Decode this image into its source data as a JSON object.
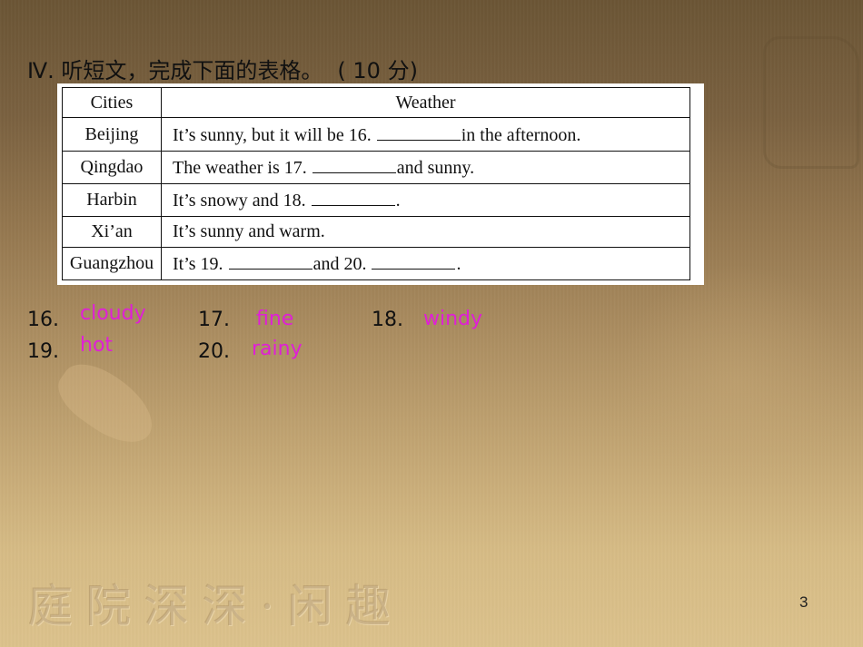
{
  "slide": {
    "heading": "Ⅳ. 听短文，完成下面的表格。",
    "score": "( 10 分)",
    "page_number": "3",
    "footer_seal_text": "庭院深深·闲趣"
  },
  "table": {
    "headers": [
      "Cities",
      "Weather"
    ],
    "rows": [
      {
        "city": "Beijing",
        "before": "It’s sunny, but it will be 16.",
        "blank_after": true,
        "after": "in the afternoon.",
        "before2": "",
        "blank2": false,
        "after2": ""
      },
      {
        "city": "Qingdao",
        "before": "The weather is 17.",
        "blank_after": true,
        "after": "and sunny.",
        "before2": "",
        "blank2": false,
        "after2": ""
      },
      {
        "city": "Harbin",
        "before": "It’s snowy and 18.",
        "blank_after": true,
        "after": ".",
        "before2": "",
        "blank2": false,
        "after2": ""
      },
      {
        "city": "Xi’an",
        "before": "It’s sunny and warm.",
        "blank_after": false,
        "after": "",
        "before2": "",
        "blank2": false,
        "after2": ""
      },
      {
        "city": "Guangzhou",
        "before": "It’s 19.",
        "blank_after": true,
        "after": "and 20.",
        "before2": "",
        "blank2": true,
        "after2": "."
      }
    ]
  },
  "answers": [
    {
      "number": "16.",
      "answer": "cloudy"
    },
    {
      "number": "17.",
      "answer": "fine"
    },
    {
      "number": "18.",
      "answer": "windy"
    },
    {
      "number": "19.",
      "answer": "hot"
    },
    {
      "number": "20.",
      "answer": "rainy"
    }
  ],
  "colors": {
    "answer": "#e01fd6",
    "text": "#111111"
  }
}
